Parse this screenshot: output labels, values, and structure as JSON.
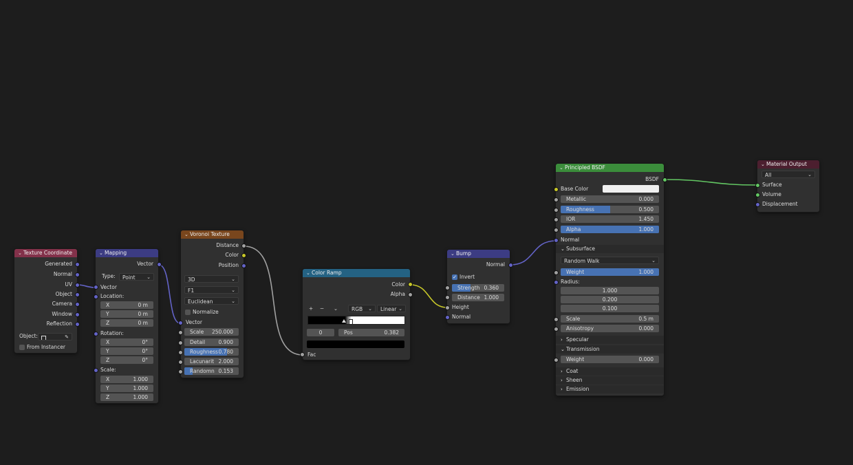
{
  "colors": {
    "background": "#1d1d1d",
    "node_body": "#303030",
    "field": "#545454",
    "accent": "#4772b3",
    "hdr_input": "#83314a",
    "hdr_vector": "#3c3c83",
    "hdr_texture": "#79461d",
    "hdr_converter": "#246283",
    "hdr_shader": "#3b8d3b",
    "hdr_output": "#4c1f2f"
  },
  "tex_coord": {
    "title": "Texture Coordinate",
    "icon": "chevron-down-icon",
    "outputs": [
      "Generated",
      "Normal",
      "UV",
      "Object",
      "Camera",
      "Window",
      "Reflection"
    ],
    "object_label": "Object:",
    "from_instancer": "From Instancer"
  },
  "mapping": {
    "title": "Mapping",
    "output": "Vector",
    "type_label": "Type:",
    "type_value": "Point",
    "input_vector": "Vector",
    "location_label": "Location:",
    "location": [
      {
        "axis": "X",
        "value": "0 m"
      },
      {
        "axis": "Y",
        "value": "0 m"
      },
      {
        "axis": "Z",
        "value": "0 m"
      }
    ],
    "rotation_label": "Rotation:",
    "rotation": [
      {
        "axis": "X",
        "value": "0°"
      },
      {
        "axis": "Y",
        "value": "0°"
      },
      {
        "axis": "Z",
        "value": "0°"
      }
    ],
    "scale_label": "Scale:",
    "scale": [
      {
        "axis": "X",
        "value": "1.000"
      },
      {
        "axis": "Y",
        "value": "1.000"
      },
      {
        "axis": "Z",
        "value": "1.000"
      }
    ]
  },
  "voronoi": {
    "title": "Voronoi Texture",
    "outputs": [
      "Distance",
      "Color",
      "Position"
    ],
    "dimensions": "3D",
    "feature": "F1",
    "metric": "Euclidean",
    "normalize": "Normalize",
    "input_vector": "Vector",
    "scale": {
      "label": "Scale",
      "value": "250.000",
      "fill": 0
    },
    "detail": {
      "label": "Detail",
      "value": "0.900",
      "fill": 0
    },
    "roughness": {
      "label": "Roughness",
      "value": "0.780",
      "fill": 0.78
    },
    "lacunarity": {
      "label": "Lacunarit",
      "value": "2.000",
      "fill": 0
    },
    "randomness": {
      "label": "Randomn",
      "value": "0.153",
      "fill": 0.153
    }
  },
  "color_ramp": {
    "title": "Color Ramp",
    "outputs": [
      "Color",
      "Alpha"
    ],
    "add": "+",
    "remove": "−",
    "menu": "⌄",
    "color_mode": "RGB",
    "interpolation": "Linear",
    "stop_index": "0",
    "pos_label": "Pos",
    "pos_value": "0.382",
    "input": "Fac",
    "stops": [
      {
        "position": 0.382,
        "color": "#000000"
      },
      {
        "position": 0.45,
        "color": "#ffffff"
      }
    ]
  },
  "bump": {
    "title": "Bump",
    "output": "Normal",
    "invert": "Invert",
    "strength": {
      "label": "Strength",
      "value": "0.360",
      "fill": 0.36
    },
    "distance": {
      "label": "Distance",
      "value": "1.000",
      "fill": 0
    },
    "inputs": [
      "Height",
      "Normal"
    ]
  },
  "bsdf": {
    "title": "Principled BSDF",
    "output": "BSDF",
    "base_color_label": "Base Color",
    "base_color": "#f0f0f0",
    "metallic": {
      "label": "Metallic",
      "value": "0.000",
      "fill": 0
    },
    "roughness": {
      "label": "Roughness",
      "value": "0.500",
      "fill": 0.5
    },
    "ior": {
      "label": "IOR",
      "value": "1.450",
      "fill": 0
    },
    "alpha": {
      "label": "Alpha",
      "value": "1.000",
      "fill": 1
    },
    "normal": "Normal",
    "subsurface": "Subsurface",
    "method": "Random Walk",
    "ss_weight": {
      "label": "Weight",
      "value": "1.000",
      "fill": 1
    },
    "radius_label": "Radius:",
    "radius": [
      "1.000",
      "0.200",
      "0.100"
    ],
    "ss_scale": {
      "label": "Scale",
      "value": "0.5 m",
      "fill": 0
    },
    "anisotropy": {
      "label": "Anisotropy",
      "value": "0.000",
      "fill": 0
    },
    "specular": "Specular",
    "transmission": "Transmission",
    "tr_weight": {
      "label": "Weight",
      "value": "0.000",
      "fill": 0
    },
    "coat": "Coat",
    "sheen": "Sheen",
    "emission": "Emission"
  },
  "output": {
    "title": "Material Output",
    "target": "All",
    "inputs": [
      "Surface",
      "Volume",
      "Displacement"
    ]
  }
}
